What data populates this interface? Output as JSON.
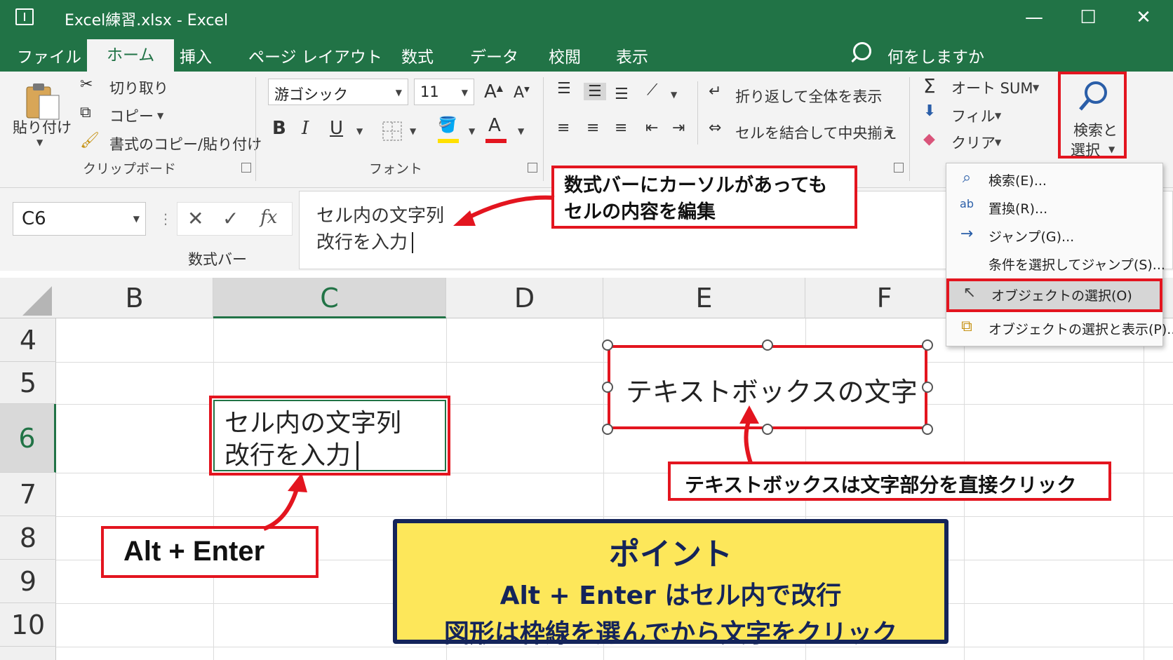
{
  "titlebar": {
    "title": "Excel練習.xlsx  -  Excel",
    "min": "—",
    "max": "☐",
    "close": "✕"
  },
  "tabs": [
    "ファイル",
    "ホーム",
    "挿入",
    "ページ レイアウト",
    "数式",
    "データ",
    "校閲",
    "表示"
  ],
  "tellme": "何をしますか",
  "clipboard": {
    "paste": "貼り付け",
    "cut": "切り取り",
    "copy": "コピー",
    "format_painter": "書式のコピー/貼り付け",
    "group": "クリップボード"
  },
  "font": {
    "name": "游ゴシック",
    "size": "11",
    "group": "フォント"
  },
  "alignment": {
    "wrap": "折り返して全体を表示",
    "merge": "セルを結合して中央揃え"
  },
  "editing": {
    "autosum": "オート SUM",
    "fill": "フィル",
    "clear": "クリア",
    "find_l1": "検索と",
    "find_l2": "選択"
  },
  "formula_bar": {
    "namebox": "C6",
    "fx": "fx",
    "caption": "数式バー",
    "line1": "セル内の文字列",
    "line2": "改行を入力"
  },
  "columns": [
    "B",
    "C",
    "D",
    "E",
    "F"
  ],
  "rows": [
    "4",
    "5",
    "6",
    "7",
    "8",
    "9",
    "10"
  ],
  "cell": {
    "line1": "セル内の文字列",
    "line2": "改行を入力"
  },
  "textbox": "テキストボックスの文字",
  "callouts": {
    "formula_l1": "数式バーにカーソルがあっても",
    "formula_l2": "セルの内容を編集",
    "textbox_hint": "テキストボックスは文字部分を直接クリック",
    "alt_enter": "Alt + Enter"
  },
  "point": {
    "title": "ポイント",
    "line1": "Alt + Enter はセル内で改行",
    "line2": "図形は枠線を選んでから文字をクリック"
  },
  "find_menu": [
    {
      "label": "検索(E)...",
      "icon": "search-icon"
    },
    {
      "label": "置換(R)...",
      "icon": "replace-icon"
    },
    {
      "label": "ジャンプ(G)...",
      "icon": "arrow-right-icon"
    },
    {
      "label": "条件を選択してジャンプ(S)...",
      "icon": ""
    },
    {
      "label": "オブジェクトの選択(O)",
      "icon": "cursor-icon"
    },
    {
      "label": "オブジェクトの選択と表示(P)...",
      "icon": "selection-pane-icon"
    }
  ],
  "colors": {
    "excel_green": "#217346",
    "callout_red": "#e3151f",
    "point_yellow": "#fde75a",
    "point_border": "#14245a"
  }
}
